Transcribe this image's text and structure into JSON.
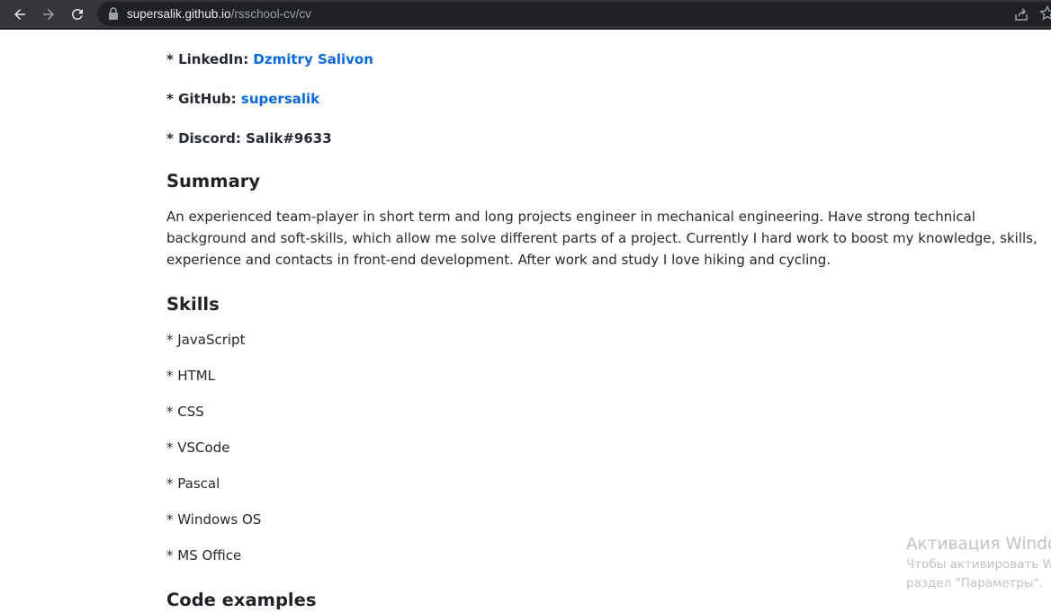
{
  "browser": {
    "url_host": "supersalik.github.io",
    "url_path": "/rsschool-cv/cv"
  },
  "contacts": {
    "linkedin_label": "* LinkedIn:",
    "linkedin_link": "Dzmitry Salivon",
    "github_label": "* GitHub:",
    "github_link": "supersalik",
    "discord": "* Discord: Salik#9633"
  },
  "summary": {
    "heading": "Summary",
    "text": "An experienced team-player in short term and long projects engineer in mechanical engineering. Have strong technical background and soft-skills, which allow me solve different parts of a project. Currently I hard work to boost my knowledge, skills, experience and contacts in front-end development. After work and study I love hiking and cycling."
  },
  "skills": {
    "heading": "Skills",
    "items": [
      "* JavaScript",
      "* HTML",
      "* CSS",
      "* VSCode",
      "* Pascal",
      "* Windows OS",
      "* MS Office"
    ]
  },
  "code_examples": {
    "heading": "Code examples"
  },
  "watermark": {
    "title": "Активация Windo",
    "line1": "Чтобы активировать W",
    "line2": "раздел \"Параметры\"."
  }
}
